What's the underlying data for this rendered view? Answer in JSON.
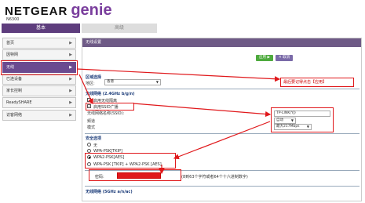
{
  "brand": {
    "name": "NETGEAR",
    "product": "genie",
    "model": "N6300"
  },
  "tabs": [
    {
      "label": "基本"
    },
    {
      "label": "高级"
    }
  ],
  "sidebar": {
    "items": [
      {
        "label": "首页"
      },
      {
        "label": "因特网"
      },
      {
        "label": "无线"
      },
      {
        "label": "已连设备"
      },
      {
        "label": "家长控制"
      },
      {
        "label": "ReadySHARE"
      },
      {
        "label": "访客网络"
      }
    ],
    "active_index": 2
  },
  "panel": {
    "title": "无线设置",
    "apply_label": "应用 ▶",
    "cancel_label": "✕ 取消",
    "note": "最后要记得点击【应用】",
    "region_section": "区域选择",
    "region_label": "地区:",
    "region_value": "香港",
    "band_section": "无线网络 (2.4GHz b/g/n)",
    "enable_radio_label": "启用无线隔离",
    "broadcast_label": "启用SSID广播",
    "ssid_label": "无线网络名称(SSID):",
    "ssid_value": "TP-LINK(YJ)",
    "channel_label": "频道",
    "channel_value": "自动",
    "mode_label": "模式",
    "mode_value": "最大217Mbps",
    "security_section": "安全选项",
    "security_options": [
      {
        "label": "无",
        "selected": false
      },
      {
        "label": "WPA-PSK[TKIP]",
        "selected": false
      },
      {
        "label": "WPA2-PSK[AES]",
        "selected": true
      },
      {
        "label": "WPA-PSK [TKIP] + WPA2-PSK [AES]",
        "selected": false
      }
    ],
    "password_label": "密码:",
    "password_value": "",
    "password_hint": "(8到63个字符或者64个十六进制数字)",
    "band5_section": "无线网络 (5GHz a/n/ac)"
  }
}
